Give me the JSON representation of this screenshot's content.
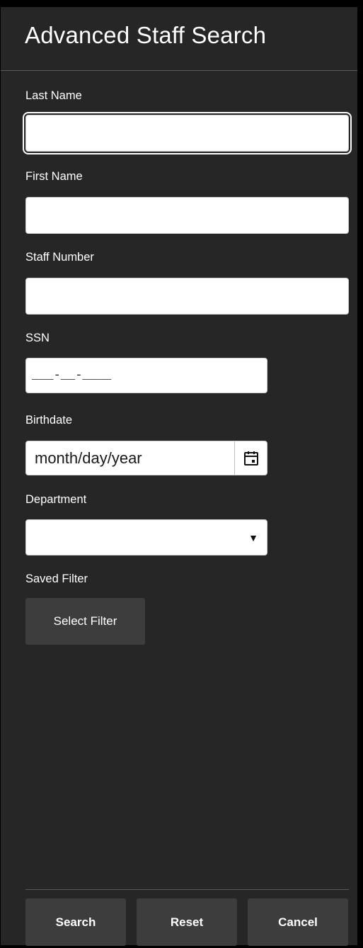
{
  "header": {
    "title": "Advanced Staff Search"
  },
  "fields": {
    "last_name": {
      "label": "Last Name",
      "value": ""
    },
    "first_name": {
      "label": "First Name",
      "value": ""
    },
    "staff_number": {
      "label": "Staff Number",
      "value": ""
    },
    "ssn": {
      "label": "SSN",
      "mask": "___-__-____"
    },
    "birthdate": {
      "label": "Birthdate",
      "placeholder": "month/day/year",
      "icon": "calendar-icon"
    },
    "department": {
      "label": "Department",
      "selected": "",
      "icon": "caret-down-icon"
    },
    "saved_filter": {
      "label": "Saved Filter",
      "button_label": "Select Filter"
    }
  },
  "footer": {
    "search_label": "Search",
    "reset_label": "Reset",
    "cancel_label": "Cancel"
  },
  "colors": {
    "panel_bg": "#262626",
    "button_bg": "#3d3d3d",
    "text": "#ffffff",
    "input_bg": "#ffffff"
  }
}
